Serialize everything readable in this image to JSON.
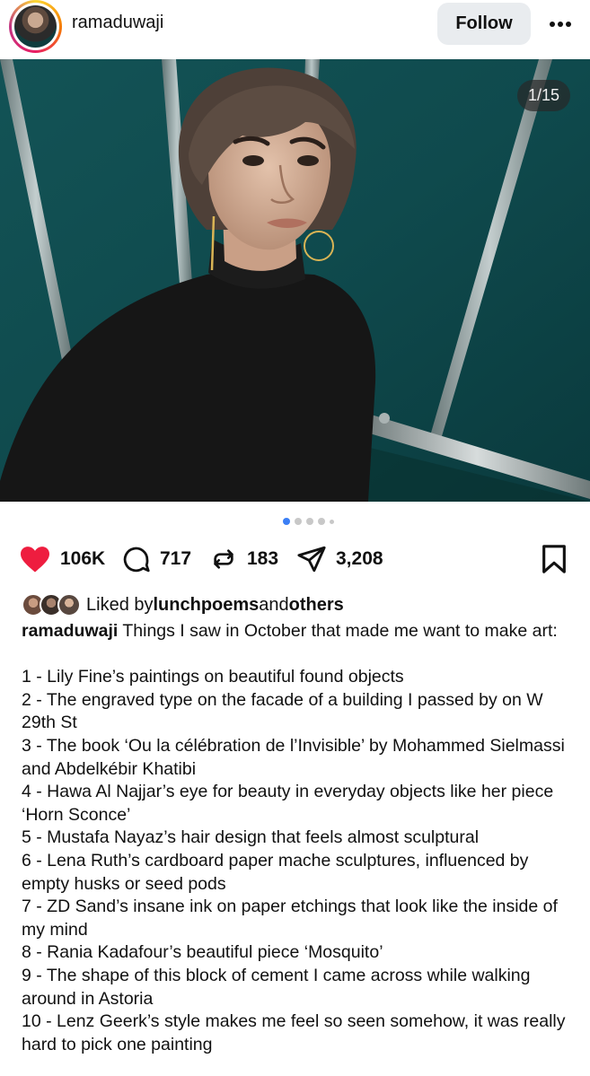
{
  "header": {
    "username": "ramaduwaji",
    "follow_label": "Follow",
    "more_icon": "ellipsis-icon"
  },
  "photo": {
    "counter": "1/15"
  },
  "carousel": {
    "total_dots": 5,
    "active_index": 0
  },
  "actions": {
    "likes": "106K",
    "comments": "717",
    "reposts": "183",
    "shares": "3,208",
    "like_color": "#ee1d3f"
  },
  "liked_by": {
    "prefix": "Liked by ",
    "user": "lunchpoems",
    "middle": " and ",
    "others": "others"
  },
  "caption": {
    "username": "ramaduwaji",
    "intro": " Things I saw in October that made me want to make art:",
    "items": [
      "1 - Lily Fine’s paintings on beautiful found objects",
      "2 - The engraved type on the facade of a building I passed by on W 29th St",
      "3 - The book ‘Ou la célébration de l’Invisible’ by Mohammed Sielmassi and Abdelkébir Khatibi",
      "4 - Hawa Al Najjar’s eye for beauty in everyday objects like her piece ‘Horn Sconce’",
      "5 - Mustafa Nayaz’s hair design that feels almost sculptural",
      "6 - Lena Ruth’s cardboard paper mache sculptures, influenced by empty husks or seed pods",
      "7 - ZD Sand’s insane ink on paper etchings that look like the inside of my mind",
      "8 - Rania Kadafour’s beautiful piece ‘Mosquito’",
      "9 - The shape of this block of cement I came across while walking around in Astoria",
      "10 - Lenz Geerk’s style makes me feel so seen somehow, it was really hard to pick one painting"
    ]
  }
}
